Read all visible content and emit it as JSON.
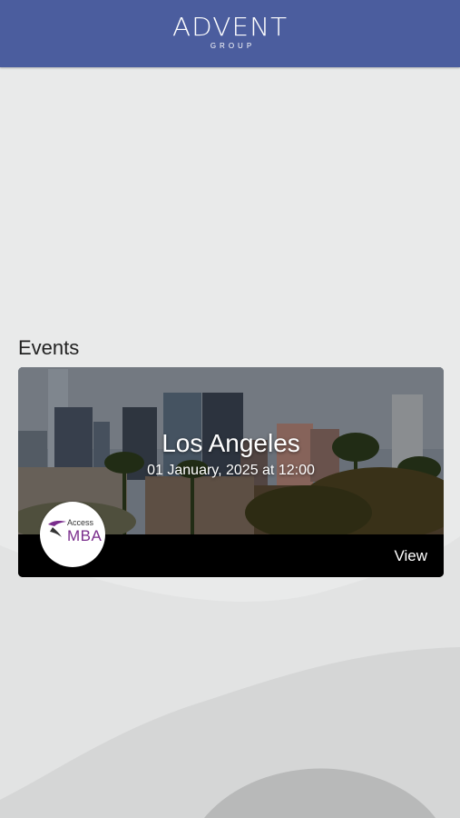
{
  "header": {
    "brand_name": "ADVENT",
    "brand_subtitle": "GROUP",
    "background_color": "#4b5d9e"
  },
  "events_section": {
    "title": "Events",
    "items": [
      {
        "city": "Los Angeles",
        "date_text": "01 January, 2025 at 12:00",
        "action_label": "View",
        "organizer_logo": {
          "icon": "access-mba-logo",
          "top_text": "Access",
          "bottom_text": "MBA",
          "accent_color": "#7a2d8c"
        },
        "image": "los-angeles-skyline-with-palm-trees"
      }
    ]
  }
}
